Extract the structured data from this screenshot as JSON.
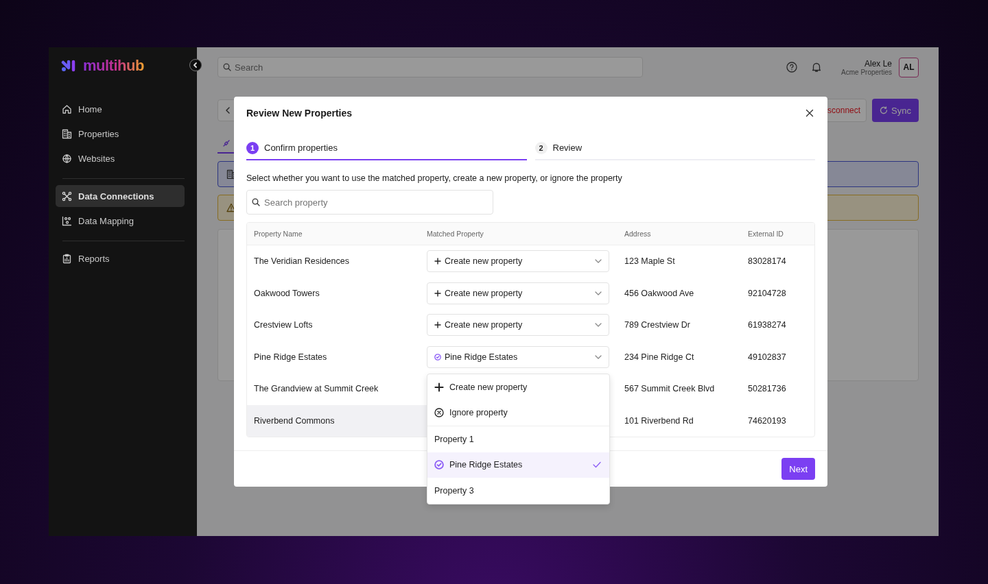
{
  "sidebar": {
    "logo": "multihub",
    "groups": [
      [
        {
          "label": "Home",
          "selected": false
        },
        {
          "label": "Properties",
          "selected": false
        },
        {
          "label": "Websites",
          "selected": false
        }
      ],
      [
        {
          "label": "Data Connections",
          "selected": true
        },
        {
          "label": "Data Mapping",
          "selected": false
        }
      ],
      [
        {
          "label": "Reports",
          "selected": false
        }
      ]
    ]
  },
  "topbar": {
    "search": {
      "placeholder": "Search"
    },
    "user": {
      "name": "Alex Le",
      "org": "Acme Properties",
      "initials": "AL"
    }
  },
  "page": {
    "buttons": [
      {
        "kind": "danger",
        "label": "sconnect"
      },
      {
        "kind": "primary",
        "label": "Sync"
      }
    ]
  },
  "modal": {
    "title": "Review New Properties",
    "steps": [
      {
        "number": "1",
        "label": "Confirm properties",
        "selected": true
      },
      {
        "number": "2",
        "label": "Review",
        "selected": false
      }
    ],
    "description": "Select whether you want to use the matched property, create a new property, or ignore the property",
    "search": {
      "placeholder": "Search property"
    },
    "table": {
      "columns": [
        "Property Name",
        "Matched Property",
        "Address",
        "External ID"
      ],
      "rows": [
        {
          "name": "The Veridian Residences",
          "matched": {
            "kind": "create",
            "label": "Create new property"
          },
          "address": "123 Maple St",
          "external_id": "83028174",
          "highlighted": false
        },
        {
          "name": "Oakwood Towers",
          "matched": {
            "kind": "create",
            "label": "Create new property"
          },
          "address": "456 Oakwood Ave",
          "external_id": "92104728",
          "highlighted": false
        },
        {
          "name": "Crestview Lofts",
          "matched": {
            "kind": "create",
            "label": "Create new property"
          },
          "address": "789 Crestview Dr",
          "external_id": "61938274",
          "highlighted": false
        },
        {
          "name": "Pine Ridge Estates",
          "matched": {
            "kind": "match",
            "label": "Pine Ridge Estates"
          },
          "address": "234 Pine Ridge Ct",
          "external_id": "49102837",
          "highlighted": false
        },
        {
          "name": "The Grandview at Summit Creek",
          "address": "567 Summit Creek Blvd",
          "external_id": "50281736",
          "highlighted": false
        },
        {
          "name": "Riverbend Commons",
          "address": "101 Riverbend Rd",
          "external_id": "74620193",
          "highlighted": true
        }
      ]
    },
    "dropdown": {
      "items": [
        {
          "kind": "create",
          "label": "Create new property",
          "selected": false
        },
        {
          "kind": "ignore",
          "label": "Ignore property",
          "selected": false
        },
        {
          "kind": "option",
          "label": "Property 1",
          "selected": false
        },
        {
          "kind": "match",
          "label": "Pine Ridge Estates",
          "selected": true
        },
        {
          "kind": "option",
          "label": "Property 3",
          "selected": false
        }
      ]
    },
    "next_button": "Next"
  }
}
